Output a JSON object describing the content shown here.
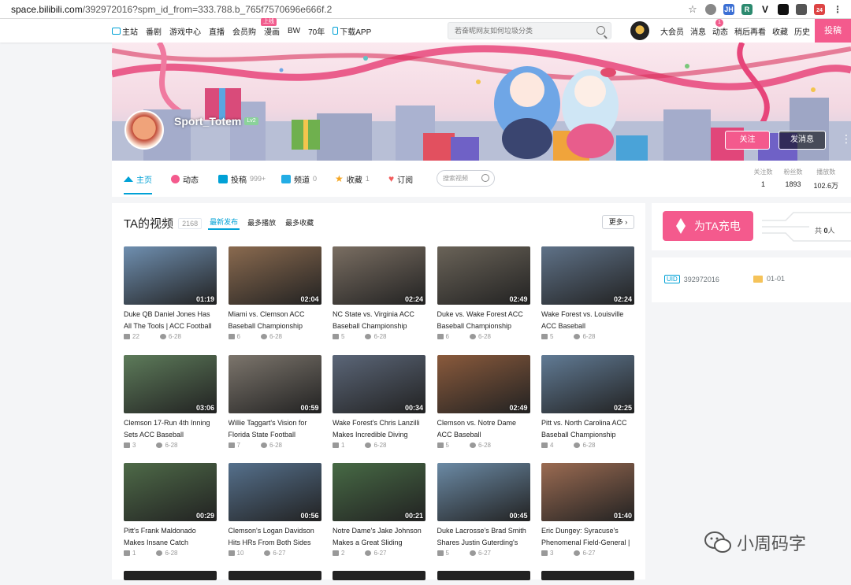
{
  "browser": {
    "url_host": "space.bilibili.com",
    "url_path": "/392972016?spm_id_from=333.788.b_765f7570696e666f.2",
    "icons": [
      "star-icon",
      "globe-icon",
      "jh-extension-icon",
      "r-extension-icon",
      "v-extension-icon",
      "ghost-extension-icon",
      "puzzle-extension-icon",
      "gmail-icon",
      "menu-dots-icon"
    ],
    "gmail_badge": "24"
  },
  "topnav": {
    "left": [
      "主站",
      "番剧",
      "游戏中心",
      "直播",
      "会员购",
      "漫画",
      "BW",
      "70年",
      "下载APP"
    ],
    "manga_badge": "上线",
    "search_placeholder": "若奋昵网友如何垃圾分类",
    "right": [
      "大会员",
      "消息",
      "动态",
      "稍后再看",
      "收藏",
      "历史"
    ],
    "dynamic_badge": "1",
    "upload_label": "投稿"
  },
  "profile": {
    "username": "Sport_Totem",
    "level": "Lv2",
    "follow_label": "关注",
    "message_label": "发消息",
    "tabs": [
      {
        "label": "主页",
        "count": ""
      },
      {
        "label": "动态",
        "count": ""
      },
      {
        "label": "投稿",
        "count": "999+"
      },
      {
        "label": "频道",
        "count": "0"
      },
      {
        "label": "收藏",
        "count": "1"
      },
      {
        "label": "订阅",
        "count": ""
      }
    ],
    "search_placeholder": "搜索视频",
    "stats": [
      {
        "label": "关注数",
        "value": "1"
      },
      {
        "label": "粉丝数",
        "value": "1893"
      },
      {
        "label": "播放数",
        "value": "102.6万"
      }
    ]
  },
  "videos": {
    "title": "TA的视频",
    "count": "2168",
    "sorts": [
      "最新发布",
      "最多播放",
      "最多收藏"
    ],
    "more_label": "更多",
    "items": [
      {
        "title": "Duke QB Daniel Jones Has All The Tools | ACC Football",
        "duration": "01:19",
        "plays": "22",
        "date": "6-28",
        "bg": "#6f8fb0"
      },
      {
        "title": "Miami vs. Clemson ACC Baseball Championship",
        "duration": "02:04",
        "plays": "6",
        "date": "6-28",
        "bg": "#8a6a4f"
      },
      {
        "title": "NC State vs. Virginia ACC Baseball Championship",
        "duration": "02:24",
        "plays": "5",
        "date": "6-28",
        "bg": "#7a6e62"
      },
      {
        "title": "Duke vs. Wake Forest ACC Baseball Championship",
        "duration": "02:49",
        "plays": "6",
        "date": "6-28",
        "bg": "#6a6358"
      },
      {
        "title": "Wake Forest vs. Louisville ACC Baseball",
        "duration": "02:24",
        "plays": "5",
        "date": "6-28",
        "bg": "#5f7288"
      },
      {
        "title": "Clemson 17-Run 4th Inning Sets ACC Baseball",
        "duration": "03:06",
        "plays": "3",
        "date": "6-28",
        "bg": "#5d7b5a"
      },
      {
        "title": "Willie Taggart's Vision for Florida State Football",
        "duration": "00:59",
        "plays": "7",
        "date": "6-28",
        "bg": "#7c756c"
      },
      {
        "title": "Wake Forest's Chris Lanzilli Makes Incredible Diving",
        "duration": "00:34",
        "plays": "1",
        "date": "6-28",
        "bg": "#5b6678"
      },
      {
        "title": "Clemson vs. Notre Dame ACC Baseball",
        "duration": "02:49",
        "plays": "5",
        "date": "6-28",
        "bg": "#8a5a3c"
      },
      {
        "title": "Pitt vs. North Carolina ACC Baseball Championship",
        "duration": "02:25",
        "plays": "4",
        "date": "6-28",
        "bg": "#617b95"
      },
      {
        "title": "Pitt's Frank Maldonado Makes Insane Catch",
        "duration": "00:29",
        "plays": "1",
        "date": "6-28",
        "bg": "#4e6a48"
      },
      {
        "title": "Clemson's Logan Davidson Hits HRs From Both Sides",
        "duration": "00:56",
        "plays": "10",
        "date": "6-27",
        "bg": "#55708c"
      },
      {
        "title": "Notre Dame's Jake Johnson Makes a Great Sliding",
        "duration": "00:21",
        "plays": "2",
        "date": "6-27",
        "bg": "#476a45"
      },
      {
        "title": "Duke Lacrosse's Brad Smith Shares Justin Guterding's",
        "duration": "00:45",
        "plays": "5",
        "date": "6-27",
        "bg": "#6b8aa5"
      },
      {
        "title": "Eric Dungey: Syracuse's Phenomenal Field-General |",
        "duration": "01:40",
        "plays": "3",
        "date": "6-27",
        "bg": "#9b6b52"
      }
    ]
  },
  "sidebar": {
    "charge_label": "为TA充电",
    "total_prefix": "共",
    "total_count": "0",
    "total_suffix": "人",
    "uid_tag": "UID",
    "uid": "392972016",
    "birthday": "01-01"
  },
  "watermark": "小周码字",
  "colors": {
    "accent": "#00a1d6",
    "pink": "#f45a8d"
  }
}
